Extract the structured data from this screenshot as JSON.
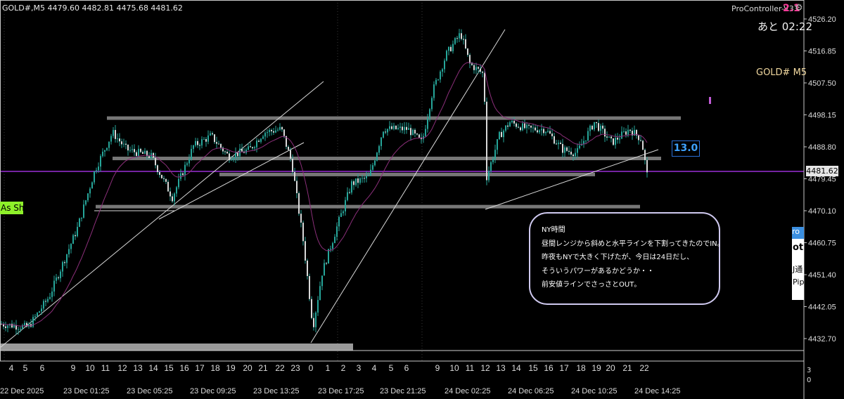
{
  "chart_header": {
    "symbol_info": "GOLD#,M5  4479.60 4482.81 4475.68 4481.62"
  },
  "controller": {
    "name": "ProController-V33",
    "count": "2.1",
    "timer": "あと 02:22"
  },
  "symbol_label": "GOLD# M5",
  "left_label": "As Sh",
  "level_label": "13.0",
  "current_price": "4481.62",
  "colors": {
    "background": "#000000",
    "candle": "#26a69a",
    "ma": "#8b2f7a",
    "price_line": "#9b2fd6",
    "zone": "#777777",
    "line": "#d9d9d9",
    "accent": "#2a6fd6"
  },
  "note": {
    "lines": [
      "NY時間",
      "昼間レンジから斜めと水平ラインを下割ってきたのでIN。",
      "昨夜もNYで大きく下げたが、今日は24日だし、",
      "そういうパワーがあるかどうか・・",
      "前安値ラインでさっさとOUT。"
    ]
  },
  "side_panel": {
    "items": [
      "ro",
      "ot",
      "J通",
      "Pip"
    ]
  },
  "chart_data": {
    "type": "line",
    "title": "GOLD#,M5",
    "ylim": [
      4428,
      4528
    ],
    "y_ticks": [
      "4526.20",
      "4516.85",
      "4507.50",
      "4498.15",
      "4488.80",
      "4479.45",
      "4470.10",
      "4460.75",
      "4451.40",
      "4442.05",
      "4432.70"
    ],
    "hour_labels": [
      "4",
      "5",
      "6",
      "9",
      "10",
      "11",
      "12",
      "13",
      "14",
      "15",
      "16",
      "17",
      "18",
      "19",
      "20",
      "21",
      "22",
      "23",
      "0",
      "1",
      "2",
      "3",
      "4",
      "5",
      "6",
      "9",
      "10",
      "11",
      "12",
      "13",
      "14",
      "15",
      "16",
      "17",
      "18",
      "19",
      "20",
      "21",
      "22"
    ],
    "date_labels": [
      "22 Dec 2025",
      "23 Dec 01:25",
      "23 Dec 05:25",
      "23 Dec 09:25",
      "23 Dec 13:25",
      "23 Dec 17:25",
      "23 Dec 21:25",
      "24 Dec 02:25",
      "24 Dec 06:25",
      "24 Dec 10:25",
      "24 Dec 14:25"
    ],
    "x": [
      "22 Dec 2025",
      "23 Dec 01:25",
      "23 Dec 05:25",
      "23 Dec 09:25",
      "23 Dec 13:25",
      "23 Dec 17:25",
      "23 Dec 21:25",
      "24 Dec 02:25",
      "24 Dec 06:25",
      "24 Dec 10:25",
      "24 Dec 14:25"
    ],
    "series": [
      {
        "values": [
          4435,
          4492,
          4478,
          4489,
          4493,
          4478,
          4490,
          4510,
          4495,
          4492,
          4480
        ]
      }
    ],
    "horizontal_levels": [
      4497.2,
      4485.4,
      4480.7,
      4471.3,
      4431.0
    ],
    "current_price": 4481.62,
    "grid": true
  }
}
